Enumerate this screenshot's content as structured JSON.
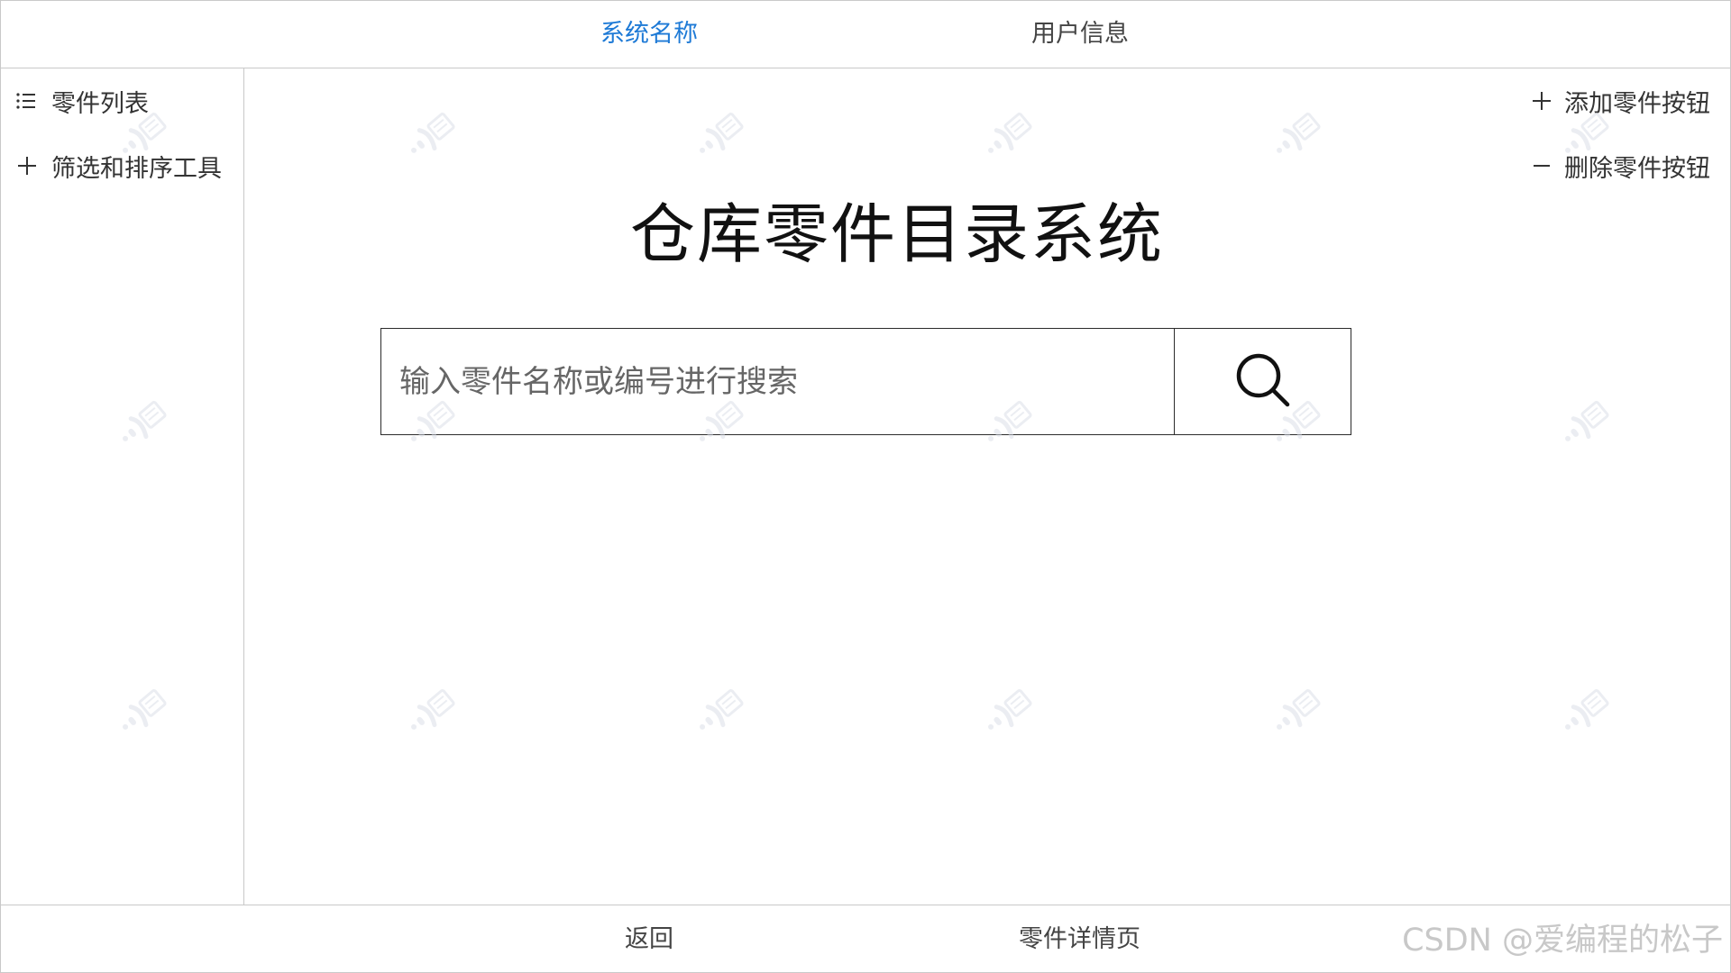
{
  "header": {
    "system_name": "系统名称",
    "user_info": "用户信息"
  },
  "sidebar": {
    "items": [
      {
        "label": "零件列表",
        "icon": "list-icon"
      },
      {
        "label": "筛选和排序工具",
        "icon": "plus-icon"
      }
    ]
  },
  "actions": {
    "add_label": "添加零件按钮",
    "delete_label": "删除零件按钮"
  },
  "main": {
    "title": "仓库零件目录系统",
    "search": {
      "placeholder": "输入零件名称或编号进行搜索",
      "button_icon": "search-icon"
    }
  },
  "footer": {
    "back": "返回",
    "detail": "零件详情页",
    "credit": "CSDN @爱编程的松子"
  },
  "colors": {
    "accent": "#1e7ad6",
    "border": "#c9c9c9",
    "watermark": "#d8dde6"
  }
}
